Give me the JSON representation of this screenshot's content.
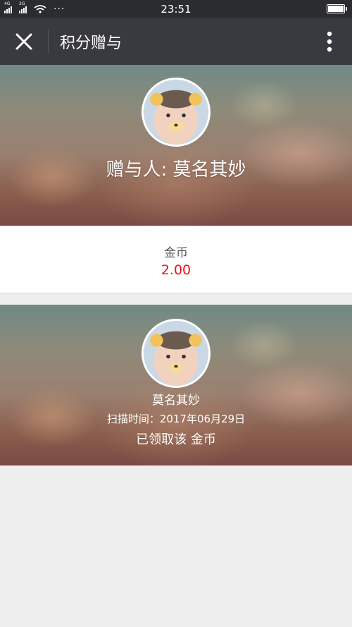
{
  "status_bar": {
    "network_1": "4G",
    "network_2": "2G",
    "more": "···",
    "time": "23:51"
  },
  "header": {
    "close_icon": "close-icon",
    "title": "积分赠与",
    "more_icon": "more-vertical-icon"
  },
  "giver": {
    "label": "赠与人: 莫名其妙"
  },
  "amount": {
    "currency": "金币",
    "value": "2.00",
    "value_color": "#e8121a"
  },
  "receiver": {
    "name": "莫名其妙",
    "scan_label": "扫描时间：",
    "scan_date": "2017年06月29日",
    "claimed_prefix": "已领取该",
    "claimed_item": "金币"
  },
  "colors": {
    "header_bg": "#393a3f",
    "status_bg": "#2b2c30",
    "page_bg": "#eeeeee"
  }
}
